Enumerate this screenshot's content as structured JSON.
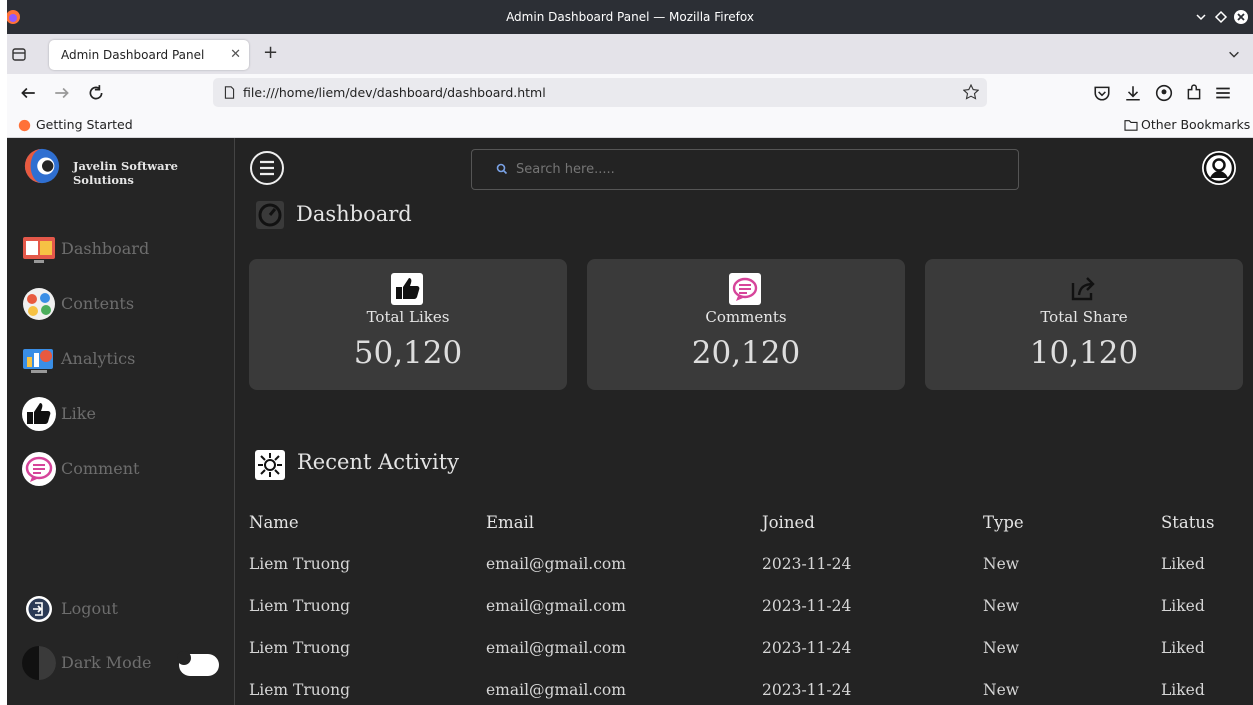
{
  "browser": {
    "window_title": "Admin Dashboard Panel — Mozilla Firefox",
    "tab_title": "Admin Dashboard Panel",
    "url": "file:///home/liem/dev/dashboard/dashboard.html",
    "bookmark_getting_started": "Getting Started",
    "bookmark_other": "Other Bookmarks"
  },
  "sidebar": {
    "brand": "Javelin Software Solutions",
    "items": [
      {
        "label": "Dashboard",
        "icon": "dashboard-icon"
      },
      {
        "label": "Contents",
        "icon": "contents-icon"
      },
      {
        "label": "Analytics",
        "icon": "analytics-icon"
      },
      {
        "label": "Like",
        "icon": "thumbs-up-icon"
      },
      {
        "label": "Comment",
        "icon": "comment-icon"
      }
    ],
    "logout": "Logout",
    "dark_mode": "Dark Mode"
  },
  "header": {
    "search_placeholder": "Search here....."
  },
  "dashboard": {
    "title": "Dashboard",
    "cards": [
      {
        "label": "Total Likes",
        "value": "50,120",
        "icon": "thumbs-up-icon"
      },
      {
        "label": "Comments",
        "value": "20,120",
        "icon": "comment-icon"
      },
      {
        "label": "Total Share",
        "value": "10,120",
        "icon": "share-icon"
      }
    ]
  },
  "activity": {
    "title": "Recent Activity",
    "columns": [
      "Name",
      "Email",
      "Joined",
      "Type",
      "Status"
    ],
    "rows": [
      [
        "Liem Truong",
        "email@gmail.com",
        "2023-11-24",
        "New",
        "Liked"
      ],
      [
        "Liem Truong",
        "email@gmail.com",
        "2023-11-24",
        "New",
        "Liked"
      ],
      [
        "Liem Truong",
        "email@gmail.com",
        "2023-11-24",
        "New",
        "Liked"
      ],
      [
        "Liem Truong",
        "email@gmail.com",
        "2023-11-24",
        "New",
        "Liked"
      ]
    ]
  },
  "colors": {
    "background": "#232323",
    "card": "#3a3a3a",
    "sidebar": "#252525"
  }
}
